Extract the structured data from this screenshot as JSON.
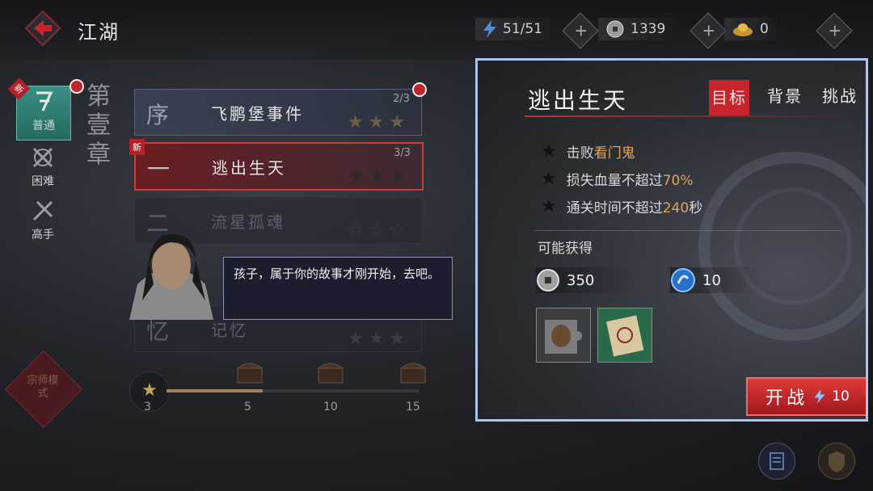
{
  "header": {
    "title": "江湖"
  },
  "resources": [
    {
      "icon": "stamina-icon",
      "value": "51/51"
    },
    {
      "icon": "silver-coin-icon",
      "value": "1339"
    },
    {
      "icon": "gold-ingot-icon",
      "value": "0"
    }
  ],
  "plus_label": "+",
  "side_tabs": [
    {
      "label": "普通",
      "new_badge": "新"
    },
    {
      "label": "困难"
    },
    {
      "label": "高手"
    }
  ],
  "chapter_label": "第壹章",
  "levels": [
    {
      "num": "序",
      "name": "飞鹏堡事件",
      "progress": "2/3",
      "stars": "★★★"
    },
    {
      "num": "一",
      "name": "逃出生天",
      "progress": "3/3",
      "stars": "★★★",
      "new_badge": "新"
    },
    {
      "num": "二",
      "name": "流星孤魂",
      "progress": "",
      "stars": "☆☆☆"
    },
    {
      "num": "忆",
      "name": "记忆",
      "progress": "",
      "stars": "★★★"
    }
  ],
  "dialog": {
    "text": "孩子，属于你的故事才刚开始，去吧。"
  },
  "progress": {
    "current": "3",
    "max": 15,
    "current_value": 3,
    "milestones": [
      "5",
      "10",
      "15"
    ]
  },
  "emblem_text": "宗师模式",
  "panel": {
    "title": "逃出生天",
    "tabs": [
      "目标",
      "背景",
      "挑战"
    ],
    "objectives": [
      {
        "prefix": "击败",
        "highlight": "看门鬼",
        "suffix": ""
      },
      {
        "prefix": "损失血量不超过",
        "highlight": "70%",
        "suffix": ""
      },
      {
        "prefix": "通关时间不超过",
        "highlight": "240",
        "suffix": "秒"
      }
    ],
    "rewards_label": "可能获得",
    "rewards": [
      {
        "icon": "silver-coin-icon",
        "value": "350"
      },
      {
        "icon": "blue-orb-icon",
        "value": "10"
      }
    ],
    "items": [
      "jar-puzzle-item-icon",
      "scroll-item-icon"
    ],
    "start_button": {
      "label": "开战",
      "cost": "10"
    }
  },
  "colors": {
    "accent_red": "#c8242c",
    "highlight": "#e0a456",
    "panel_border": "#a9c6ec"
  }
}
